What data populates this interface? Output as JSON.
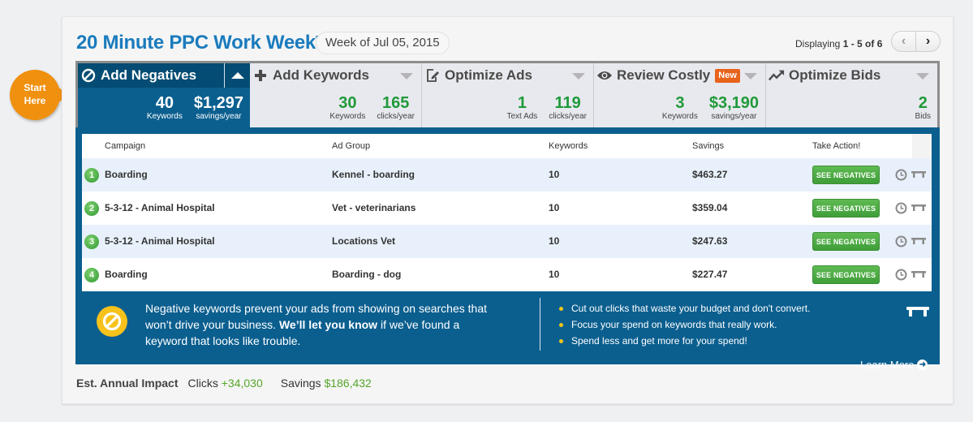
{
  "header": {
    "title": "20 Minute PPC Work Week",
    "trademark": "TM",
    "week_label": "Week of Jul 05, 2015",
    "displaying_prefix": "Displaying ",
    "displaying_range": "1 - 5 of 6",
    "pager_prev": "‹",
    "pager_next": "›"
  },
  "start_here": {
    "line1": "Start",
    "line2": "Here"
  },
  "tabs": [
    {
      "label": "Add Negatives",
      "icon": "no-entry-icon",
      "active": true,
      "stats": [
        {
          "value": "40",
          "label": "Keywords"
        },
        {
          "value": "$1,297",
          "label": "savings/year"
        }
      ]
    },
    {
      "label": "Add Keywords",
      "icon": "plus-icon",
      "active": false,
      "stats": [
        {
          "value": "30",
          "label": "Keywords"
        },
        {
          "value": "165",
          "label": "clicks/year"
        }
      ]
    },
    {
      "label": "Optimize Ads",
      "icon": "edit-icon",
      "active": false,
      "stats": [
        {
          "value": "1",
          "label": "Text Ads"
        },
        {
          "value": "119",
          "label": "clicks/year"
        }
      ]
    },
    {
      "label": "Review Costly",
      "icon": "eye-icon",
      "badge": "New",
      "active": false,
      "stats": [
        {
          "value": "3",
          "label": "Keywords"
        },
        {
          "value": "$3,190",
          "label": "savings/year"
        }
      ]
    },
    {
      "label": "Optimize Bids",
      "icon": "trend-up-icon",
      "active": false,
      "stats": [
        {
          "value": "2",
          "label": "Bids"
        }
      ]
    }
  ],
  "table": {
    "columns": [
      "Campaign",
      "Ad Group",
      "Keywords",
      "Savings",
      "Take Action!"
    ],
    "rows": [
      {
        "num": "1",
        "campaign": "Boarding",
        "ad_group": "Kennel - boarding",
        "keywords": "10",
        "savings": "$463.27",
        "action": "SEE NEGATIVES"
      },
      {
        "num": "2",
        "campaign": "5-3-12 - Animal Hospital",
        "ad_group": "Vet - veterinarians",
        "keywords": "10",
        "savings": "$359.04",
        "action": "SEE NEGATIVES"
      },
      {
        "num": "3",
        "campaign": "5-3-12 - Animal Hospital",
        "ad_group": "Locations Vet",
        "keywords": "10",
        "savings": "$247.63",
        "action": "SEE NEGATIVES"
      },
      {
        "num": "4",
        "campaign": "Boarding",
        "ad_group": "Boarding - dog",
        "keywords": "10",
        "savings": "$227.47",
        "action": "SEE NEGATIVES"
      }
    ]
  },
  "info": {
    "text_before": "Negative keywords prevent your ads from showing on searches that won’t drive your business. ",
    "text_bold": "We’ll let you know",
    "text_after": " if we’ve found a keyword that looks like trouble.",
    "bullets": [
      "Cut out clicks that waste your budget and don't convert.",
      "Focus your spend on keywords that really work.",
      "Spend less and get more for your spend!"
    ],
    "learn_more": "Learn More"
  },
  "footer": {
    "label": "Est. Annual Impact",
    "clicks_label": "Clicks",
    "clicks_value": "+34,030",
    "savings_label": "Savings",
    "savings_value": "$186,432"
  },
  "colors": {
    "brand_blue": "#1a7bbd",
    "panel_blue": "#0b5f8f",
    "stat_green": "#1f9a3a",
    "button_green": "#4cae41",
    "start_orange": "#f0900f",
    "new_badge": "#e8631b",
    "info_yellow": "#f7c21b"
  }
}
